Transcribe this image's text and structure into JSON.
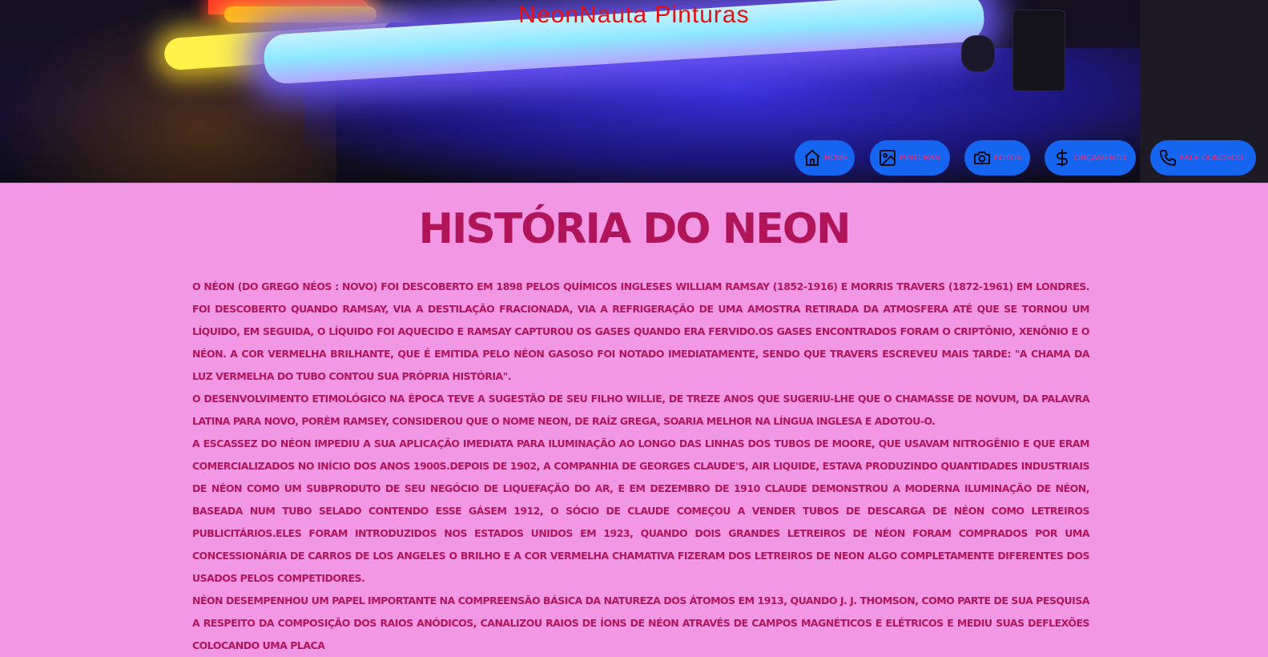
{
  "site": {
    "title": "NeonNauta Pinturas"
  },
  "nav": {
    "items": [
      {
        "label": "Home",
        "icon": "home-icon"
      },
      {
        "label": "Pinturas",
        "icon": "image-icon"
      },
      {
        "label": "Fotos",
        "icon": "camera-icon"
      },
      {
        "label": "Orçamento",
        "icon": "dollar-icon"
      },
      {
        "label": "Fale Conosco",
        "icon": "phone-icon"
      }
    ]
  },
  "colors": {
    "title": "#e51010",
    "nav_button": "#1565f0",
    "nav_label": "#ff2a6a",
    "body_bg": "#f197e3",
    "text": "#b0155a"
  },
  "main": {
    "heading": "História do Neon",
    "paragraphs": [
      "O néon (do grego néos : novo) foi descoberto em 1898 pelos químicos ingleses William Ramsay (1852-1916) e Morris Travers (1872-1961) em Londres. Foi descoberto quando Ramsay, via a destilação fracionada, via a refrigeração de uma amostra retirada da atmosfera até que se tornou um líquido, em seguida, o líquido foi aquecido e Ramsay capturou os gases quando era fervido.Os gases encontrados foram o criptônio, xenônio e o néon. A cor vermelha brilhante, que é emitida pelo néon gasoso foi notado imediatamente, sendo que Travers escreveu mais tarde: \"a chama da luz vermelha do tubo contou sua própria história\".",
      "O desenvolvimento etimológico na época teve a sugestão de seu filho Willie, de treze anos que sugeriu-lhe que o chamasse de novum, da palavra latina para novo, porém Ramsey, considerou que o nome neon, de raíz grega, soaria melhor na língua inglesa e adotou-o.",
      "A escassez do néon impediu a sua aplicação imediata para iluminação ao longo das linhas dos tubos de Moore, que usavam nitrogênio e que eram comercializados no início dos anos 1900s.Depois de 1902, a companhia de Georges Claude's, Air Liquide, estava produzindo quantidades industriais de néon como um subproduto de seu negócio de liquefação do ar, e em dezembro de 1910 Claude demonstrou a moderna iluminação de néon, baseada num tubo selado contendo esse gásEm 1912, o sócio de Claude começou a vender tubos de descarga de néon como letreiros publicitários.Eles foram introduzidos nos Estados Unidos em 1923, quando dois grandes letreiros de néon foram comprados por uma concessionária de carros de Los Angeles O brilho e a cor vermelha chamativa fizeram dos letreiros de neon algo completamente diferentes dos usados pelos competidores.",
      "Néon desempenhou um papel importante na compreensão básica da natureza dos átomos em 1913, quando J. J. Thomson, como parte de sua pesquisa a respeito da composição dos raios anódicos, canalizou raios de íons de néon através de campos magnéticos e elétricos e mediu suas deflexões colocando uma placa"
    ]
  }
}
